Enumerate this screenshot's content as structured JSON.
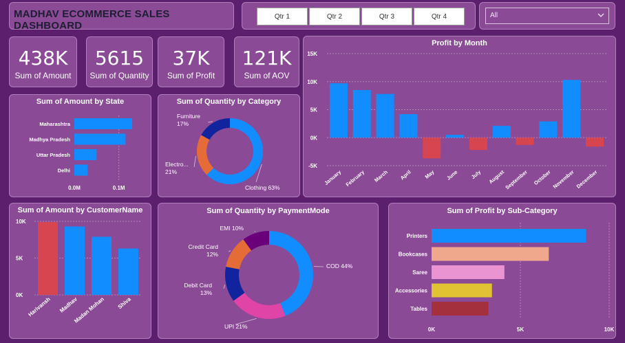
{
  "header": {
    "title": "MADHAV ECOMMERCE SALES DASHBOARD"
  },
  "slicer": {
    "quarters": [
      "Qtr 1",
      "Qtr 2",
      "Qtr 3",
      "Qtr 4"
    ],
    "dropdown_value": "All"
  },
  "kpis": [
    {
      "value": "438K",
      "label": "Sum of Amount"
    },
    {
      "value": "5615",
      "label": "Sum of Quantity"
    },
    {
      "value": "37K",
      "label": "Sum of Profit"
    },
    {
      "value": "121K",
      "label": "Sum of AOV"
    }
  ],
  "colors": {
    "background": "#5c1f6e",
    "panel": "#8a4a96",
    "positive": "#118dff",
    "negative": "#d64550"
  },
  "chart_data": [
    {
      "id": "state",
      "type": "bar",
      "orientation": "horizontal",
      "title": "Sum of Amount by State",
      "categories": [
        "Maharashtra",
        "Madhya Pradesh",
        "Uttar Pradesh",
        "Delhi"
      ],
      "values": [
        0.13,
        0.115,
        0.05,
        0.03
      ],
      "xlim": [
        0,
        0.15
      ],
      "xticks": [
        {
          "v": 0,
          "label": "0.0M"
        },
        {
          "v": 0.1,
          "label": "0.1M"
        }
      ],
      "colors": [
        "#118dff"
      ]
    },
    {
      "id": "category",
      "type": "pie",
      "donut": true,
      "title": "Sum of Quantity by Category",
      "labels": [
        "Clothing",
        "Electronics",
        "Furniture"
      ],
      "display_labels": [
        "Clothing 63%",
        "Electro... 21%",
        "Furniture 17%"
      ],
      "values": [
        63,
        21,
        17
      ],
      "colors": [
        "#118dff",
        "#e66c37",
        "#12239e"
      ]
    },
    {
      "id": "month",
      "type": "bar",
      "title": "Profit by Month",
      "categories": [
        "January",
        "February",
        "March",
        "April",
        "May",
        "June",
        "July",
        "August",
        "September",
        "October",
        "November",
        "December"
      ],
      "values": [
        9700,
        8500,
        7800,
        4200,
        -3700,
        500,
        -2200,
        2100,
        -1300,
        2900,
        10300,
        -1600
      ],
      "ylim": [
        -5000,
        15000
      ],
      "yticks": [
        {
          "v": 15000,
          "label": "15K"
        },
        {
          "v": 10000,
          "label": "10K"
        },
        {
          "v": 5000,
          "label": "5K"
        },
        {
          "v": 0,
          "label": "0K"
        },
        {
          "v": -5000,
          "label": "-5K"
        }
      ],
      "colors": [
        "#118dff",
        "#d64550"
      ]
    },
    {
      "id": "customer",
      "type": "bar",
      "title": "Sum of Amount by CustomerName",
      "categories": [
        "Harivansh",
        "Madhav",
        "Madan Mohan",
        "Shiva"
      ],
      "values": [
        9900,
        9300,
        7900,
        6300
      ],
      "ylim": [
        0,
        10000
      ],
      "yticks": [
        {
          "v": 10000,
          "label": "10K"
        },
        {
          "v": 5000,
          "label": "5K"
        },
        {
          "v": 0,
          "label": "0K"
        }
      ],
      "colors": [
        "#d64550",
        "#118dff",
        "#118dff",
        "#118dff"
      ]
    },
    {
      "id": "payment",
      "type": "pie",
      "donut": true,
      "title": "Sum of Quantity by PaymentMode",
      "labels": [
        "COD",
        "UPI",
        "Debit Card",
        "Credit Card",
        "EMI"
      ],
      "display_labels": [
        "COD 44%",
        "UPI 21%",
        "Debit Card 13%",
        "Credit Card 12%",
        "EMI 10%"
      ],
      "values": [
        44,
        21,
        13,
        12,
        10
      ],
      "colors": [
        "#118dff",
        "#e044a7",
        "#12239e",
        "#e66c37",
        "#6b007b"
      ]
    },
    {
      "id": "subcategory",
      "type": "bar",
      "orientation": "horizontal",
      "title": "Sum of Profit by Sub-Category",
      "categories": [
        "Printers",
        "Bookcases",
        "Saree",
        "Accessories",
        "Tables"
      ],
      "values": [
        8700,
        6600,
        4100,
        3400,
        3200
      ],
      "xlim": [
        0,
        10000
      ],
      "xticks": [
        {
          "v": 0,
          "label": "0K"
        },
        {
          "v": 5000,
          "label": "5K"
        },
        {
          "v": 10000,
          "label": "10K"
        }
      ],
      "colors": [
        "#118dff",
        "#f0a88c",
        "#ea94d2",
        "#e1c233",
        "#a4303c"
      ]
    }
  ]
}
